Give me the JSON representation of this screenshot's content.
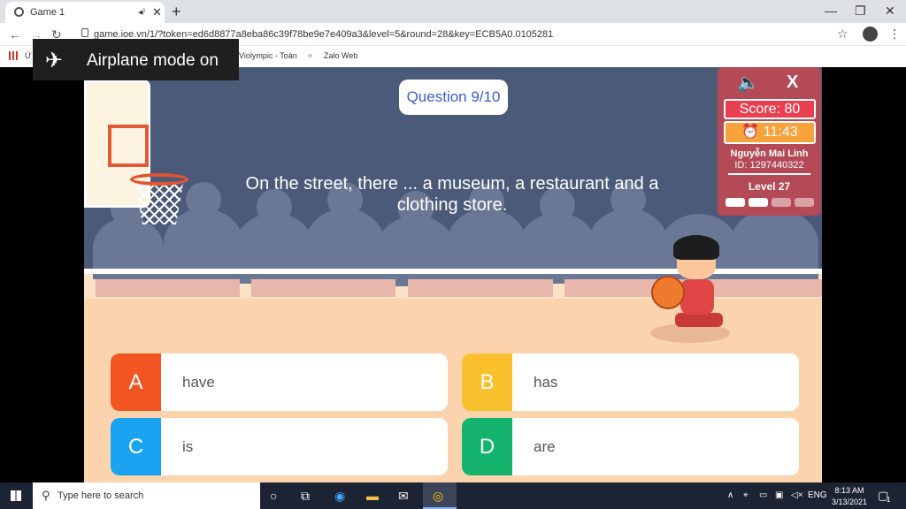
{
  "browser": {
    "tab_title": "Game 1",
    "tab_mute": "◂⁾",
    "tab_close": "✕",
    "new_tab": "+",
    "url": "game.ioe.vn/1/?token=ed6d8877a8eba86c39f78be9e7e409a3&level=5&round=28&key=ECB5A0.0105281",
    "bookmarks": [
      "Ứ",
      "Violympic - Toán",
      "Zalo Web"
    ],
    "window_controls": [
      "—",
      "❐",
      "✕"
    ]
  },
  "notification": {
    "icon": "airplane-icon",
    "text": "Airplane mode on"
  },
  "game": {
    "question_badge": "Question 9/10",
    "question_text": "On the street, there ... a museum, a restaurant and a clothing store.",
    "answers": [
      {
        "letter": "A",
        "text": "have",
        "color": "#f25522"
      },
      {
        "letter": "B",
        "text": "has",
        "color": "#fbc02d"
      },
      {
        "letter": "C",
        "text": "is",
        "color": "#1aa3f0"
      },
      {
        "letter": "D",
        "text": "are",
        "color": "#14b36e"
      }
    ]
  },
  "panel": {
    "close": "X",
    "score": "Score:  80",
    "timer": "⏰ 11:43",
    "player_name": "Nguyễn Mai Linh",
    "player_id": "ID: 1297440322",
    "level": "Level 27",
    "progress_filled": 2,
    "progress_total": 4
  },
  "taskbar": {
    "search_placeholder": "Type here to search",
    "language": "ENG",
    "time": "8:13 AM",
    "date": "3/13/2021",
    "notification_count": "1"
  }
}
